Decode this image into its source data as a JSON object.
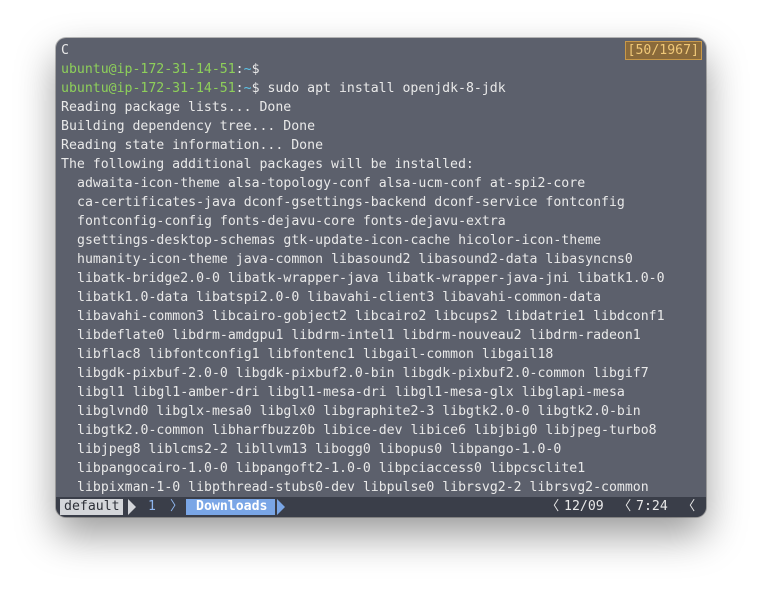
{
  "terminal": {
    "pane_label": "C",
    "scroll_position": "[50/1967]",
    "prompt": {
      "user_host": "ubuntu@ip-172-31-14-51",
      "separator": ":",
      "path": "~",
      "symbol": "$"
    },
    "command": "sudo apt install openjdk-8-jdk",
    "output_lines": [
      "Reading package lists... Done",
      "Building dependency tree... Done",
      "Reading state information... Done",
      "The following additional packages will be installed:"
    ],
    "package_lines": [
      "adwaita-icon-theme alsa-topology-conf alsa-ucm-conf at-spi2-core",
      "ca-certificates-java dconf-gsettings-backend dconf-service fontconfig",
      "fontconfig-config fonts-dejavu-core fonts-dejavu-extra",
      "gsettings-desktop-schemas gtk-update-icon-cache hicolor-icon-theme",
      "humanity-icon-theme java-common libasound2 libasound2-data libasyncns0",
      "libatk-bridge2.0-0 libatk-wrapper-java libatk-wrapper-java-jni libatk1.0-0",
      "libatk1.0-data libatspi2.0-0 libavahi-client3 libavahi-common-data",
      "libavahi-common3 libcairo-gobject2 libcairo2 libcups2 libdatrie1 libdconf1",
      "libdeflate0 libdrm-amdgpu1 libdrm-intel1 libdrm-nouveau2 libdrm-radeon1",
      "libflac8 libfontconfig1 libfontenc1 libgail-common libgail18",
      "libgdk-pixbuf-2.0-0 libgdk-pixbuf2.0-bin libgdk-pixbuf2.0-common libgif7",
      "libgl1 libgl1-amber-dri libgl1-mesa-dri libgl1-mesa-glx libglapi-mesa",
      "libglvnd0 libglx-mesa0 libglx0 libgraphite2-3 libgtk2.0-0 libgtk2.0-bin",
      "libgtk2.0-common libharfbuzz0b libice-dev libice6 libjbig0 libjpeg-turbo8",
      "libjpeg8 liblcms2-2 libllvm13 libogg0 libopus0 libpango-1.0-0",
      "libpangocairo-1.0-0 libpangoft2-1.0-0 libpciaccess0 libpcsclite1",
      "libpixman-1-0 libpthread-stubs0-dev libpulse0 librsvg2-2 librsvg2-common"
    ]
  },
  "statusbar": {
    "session_name": "default",
    "window_index": "1",
    "active_window_name": "Downloads",
    "date": "12/09",
    "time": "7:24",
    "colors": {
      "session_bg": "#d4d6da",
      "active_bg": "#7aa6e6",
      "bar_bg": "#3a3e49"
    }
  },
  "icons": {
    "separator_right": "chevron-right-icon",
    "separator_left": "chevron-left-icon"
  }
}
